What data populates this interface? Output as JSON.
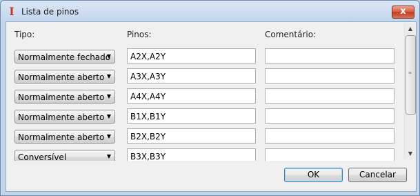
{
  "window": {
    "title": "Lista de pinos",
    "close_glyph": "x"
  },
  "headers": {
    "tipo": "Tipo:",
    "pinos": "Pinos:",
    "comentario": "Comentário:"
  },
  "rows": [
    {
      "tipo": "Normalmente fechado",
      "pinos": "A2X,A2Y",
      "comentario": ""
    },
    {
      "tipo": "Normalmente aberto",
      "pinos": "A3X,A3Y",
      "comentario": ""
    },
    {
      "tipo": "Normalmente aberto",
      "pinos": "A4X,A4Y",
      "comentario": ""
    },
    {
      "tipo": "Normalmente aberto",
      "pinos": "B1X,B1Y",
      "comentario": ""
    },
    {
      "tipo": "Normalmente aberto",
      "pinos": "B2X,B2Y",
      "comentario": ""
    },
    {
      "tipo": "Conversível",
      "pinos": "B3X,B3Y",
      "comentario": ""
    }
  ],
  "buttons": {
    "ok": "OK",
    "cancel": "Cancelar"
  },
  "icons": {
    "app": "app-logo-icon",
    "dropdown": "chevron-down-icon"
  }
}
